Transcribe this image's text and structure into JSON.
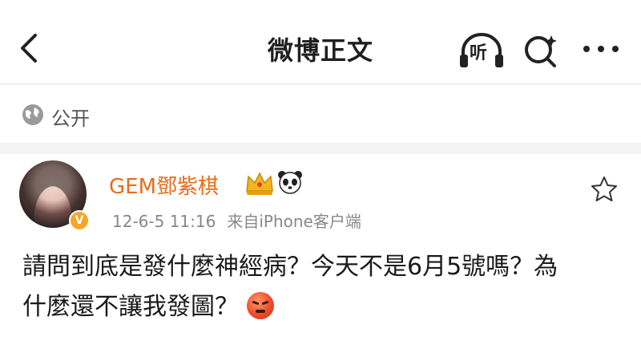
{
  "header": {
    "title": "微博正文",
    "listen_label": "听",
    "icons": [
      "back-chevron-icon",
      "listen-headphones-icon",
      "search-icon",
      "more-dots-icon"
    ]
  },
  "visibility": {
    "icon": "globe-icon",
    "label": "公开"
  },
  "post": {
    "author": "GEM鄧紫棋",
    "verified_badge": "V",
    "time": "12-6-5 11:16",
    "source": "来自iPhone客户端",
    "text_lines": [
      "請問到底是發什麼神經病？今天不是6月5號嗎？為",
      "什麼還不讓我發圖？"
    ],
    "emoji": "angry-face-emoji",
    "badges": [
      "crown-badge-icon",
      "panda-badge-icon"
    ],
    "favorite_icon": "star-icon"
  },
  "colors": {
    "username": "#e86c1a",
    "meta": "#888888",
    "verified": "#f5a623",
    "divider": "#efefef"
  }
}
